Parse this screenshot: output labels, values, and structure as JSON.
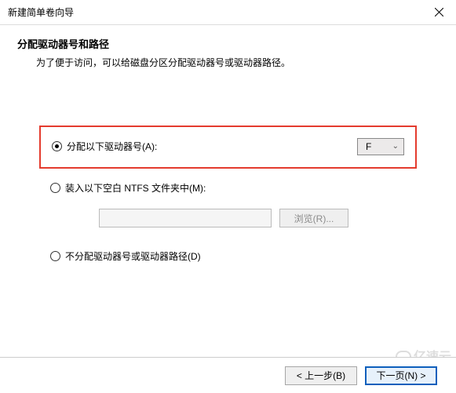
{
  "window": {
    "title": "新建简单卷向导"
  },
  "header": {
    "title": "分配驱动器号和路径",
    "desc": "为了便于访问，可以给磁盘分区分配驱动器号或驱动器路径。"
  },
  "options": {
    "assign_letter": {
      "label": "分配以下驱动器号(A):",
      "checked": true
    },
    "mount_folder": {
      "label": "装入以下空白 NTFS 文件夹中(M):",
      "checked": false
    },
    "no_assign": {
      "label": "不分配驱动器号或驱动器路径(D)",
      "checked": false
    }
  },
  "drive_select": {
    "value": "F"
  },
  "path_input": {
    "value": ""
  },
  "browse_btn": {
    "label": "浏览(R)..."
  },
  "footer": {
    "back": "< 上一步(B)",
    "next": "下一页(N) >"
  },
  "watermark": "亿速云"
}
